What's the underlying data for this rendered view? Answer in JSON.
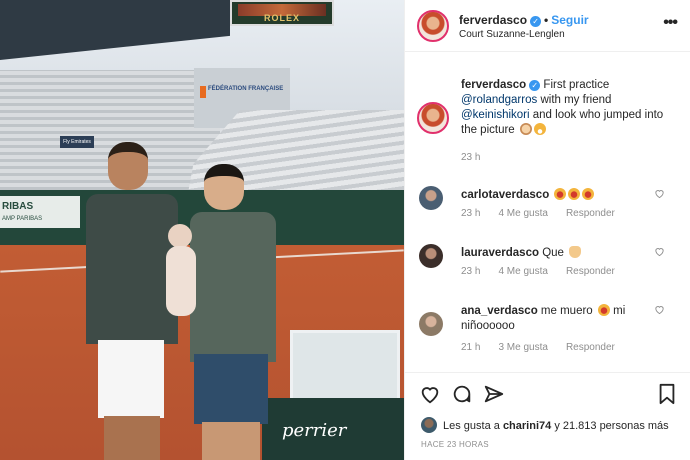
{
  "photo": {
    "scoreboard_brand": "ROLEX",
    "tower_sign": "FÉDÉRATION FRANÇAISE",
    "wall_sign": "RIBAS",
    "wall_sign_small": "AMP PARIBAS",
    "bench_brand": "perrier",
    "board_sign": "Fly Emirates"
  },
  "header": {
    "username": "ferverdasco",
    "verified_mark": "✓",
    "separator": "•",
    "follow_label": "Seguir",
    "location": "Court Suzanne-Lenglen",
    "more_icon": "•••"
  },
  "caption": {
    "username": "ferverdasco",
    "text_1": "First practice",
    "mention_1": "@rolandgarros",
    "text_2": "with my friend",
    "mention_2": "@keinishikori",
    "text_3": "and look who jumped into the picture",
    "time": "23 h"
  },
  "comments": [
    {
      "username": "carlotaverdasco",
      "text": "",
      "time": "23 h",
      "likes": "4 Me gusta",
      "reply": "Responder"
    },
    {
      "username": "lauraverdasco",
      "text": "Que",
      "time": "23 h",
      "likes": "4 Me gusta",
      "reply": "Responder"
    },
    {
      "username": "ana_verdasco",
      "text": "me muero",
      "text_after": "mi niñoooooo",
      "time": "21 h",
      "likes": "3 Me gusta",
      "reply": "Responder"
    }
  ],
  "actions": {
    "likes_prefix": "Les gusta a",
    "likes_user": "charini74",
    "likes_suffix": "y 21.813 personas más",
    "time_ago": "HACE 23 HORAS"
  },
  "colors": {
    "link": "#3897f0",
    "mention": "#00376b",
    "muted": "#8e8e8e"
  }
}
